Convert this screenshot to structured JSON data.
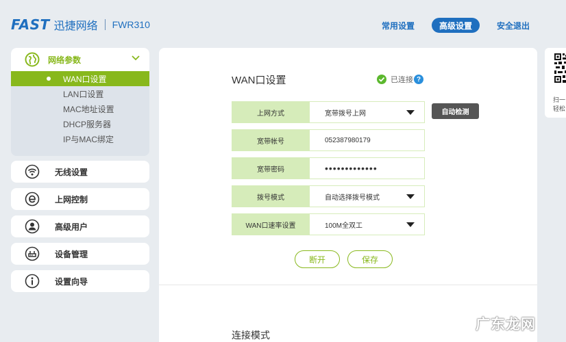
{
  "header": {
    "logo_brand": "FAST",
    "logo_cn": "迅捷网络",
    "model": "FWR310",
    "nav": [
      "常用设置",
      "高级设置",
      "安全退出"
    ]
  },
  "sidebar": {
    "group": {
      "label": "网络参数",
      "icon": "globe-icon",
      "items": [
        "WAN口设置",
        "LAN口设置",
        "MAC地址设置",
        "DHCP服务器",
        "IP与MAC绑定"
      ],
      "active_index": 0
    },
    "items": [
      {
        "label": "无线设置",
        "icon": "wifi-icon"
      },
      {
        "label": "上网控制",
        "icon": "internet-e-icon"
      },
      {
        "label": "高级用户",
        "icon": "user-icon"
      },
      {
        "label": "设备管理",
        "icon": "router-icon"
      },
      {
        "label": "设置向导",
        "icon": "info-icon"
      }
    ]
  },
  "main": {
    "title": "WAN口设置",
    "status": "已连接",
    "help": "?",
    "fields": [
      {
        "label": "上网方式",
        "value": "宽带拨号上网",
        "type": "select"
      },
      {
        "label": "宽带帐号",
        "value": "052387980179",
        "type": "text"
      },
      {
        "label": "宽带密码",
        "value": "•••••••••••••",
        "type": "password"
      },
      {
        "label": "拨号模式",
        "value": "自动选择拨号模式",
        "type": "select"
      },
      {
        "label": "WAN口速率设置",
        "value": "100M全双工",
        "type": "select"
      }
    ],
    "auto_detect": "自动检测",
    "disconnect": "断开",
    "save": "保存",
    "section2_title": "连接模式"
  },
  "qr_card": {
    "text_line1": "扫一",
    "text_line2": "轻松"
  },
  "watermark": "广东龙网",
  "colors": {
    "accent_green": "#88b81c",
    "brand_blue": "#1f6fbf",
    "label_bg": "#d6ecba"
  }
}
